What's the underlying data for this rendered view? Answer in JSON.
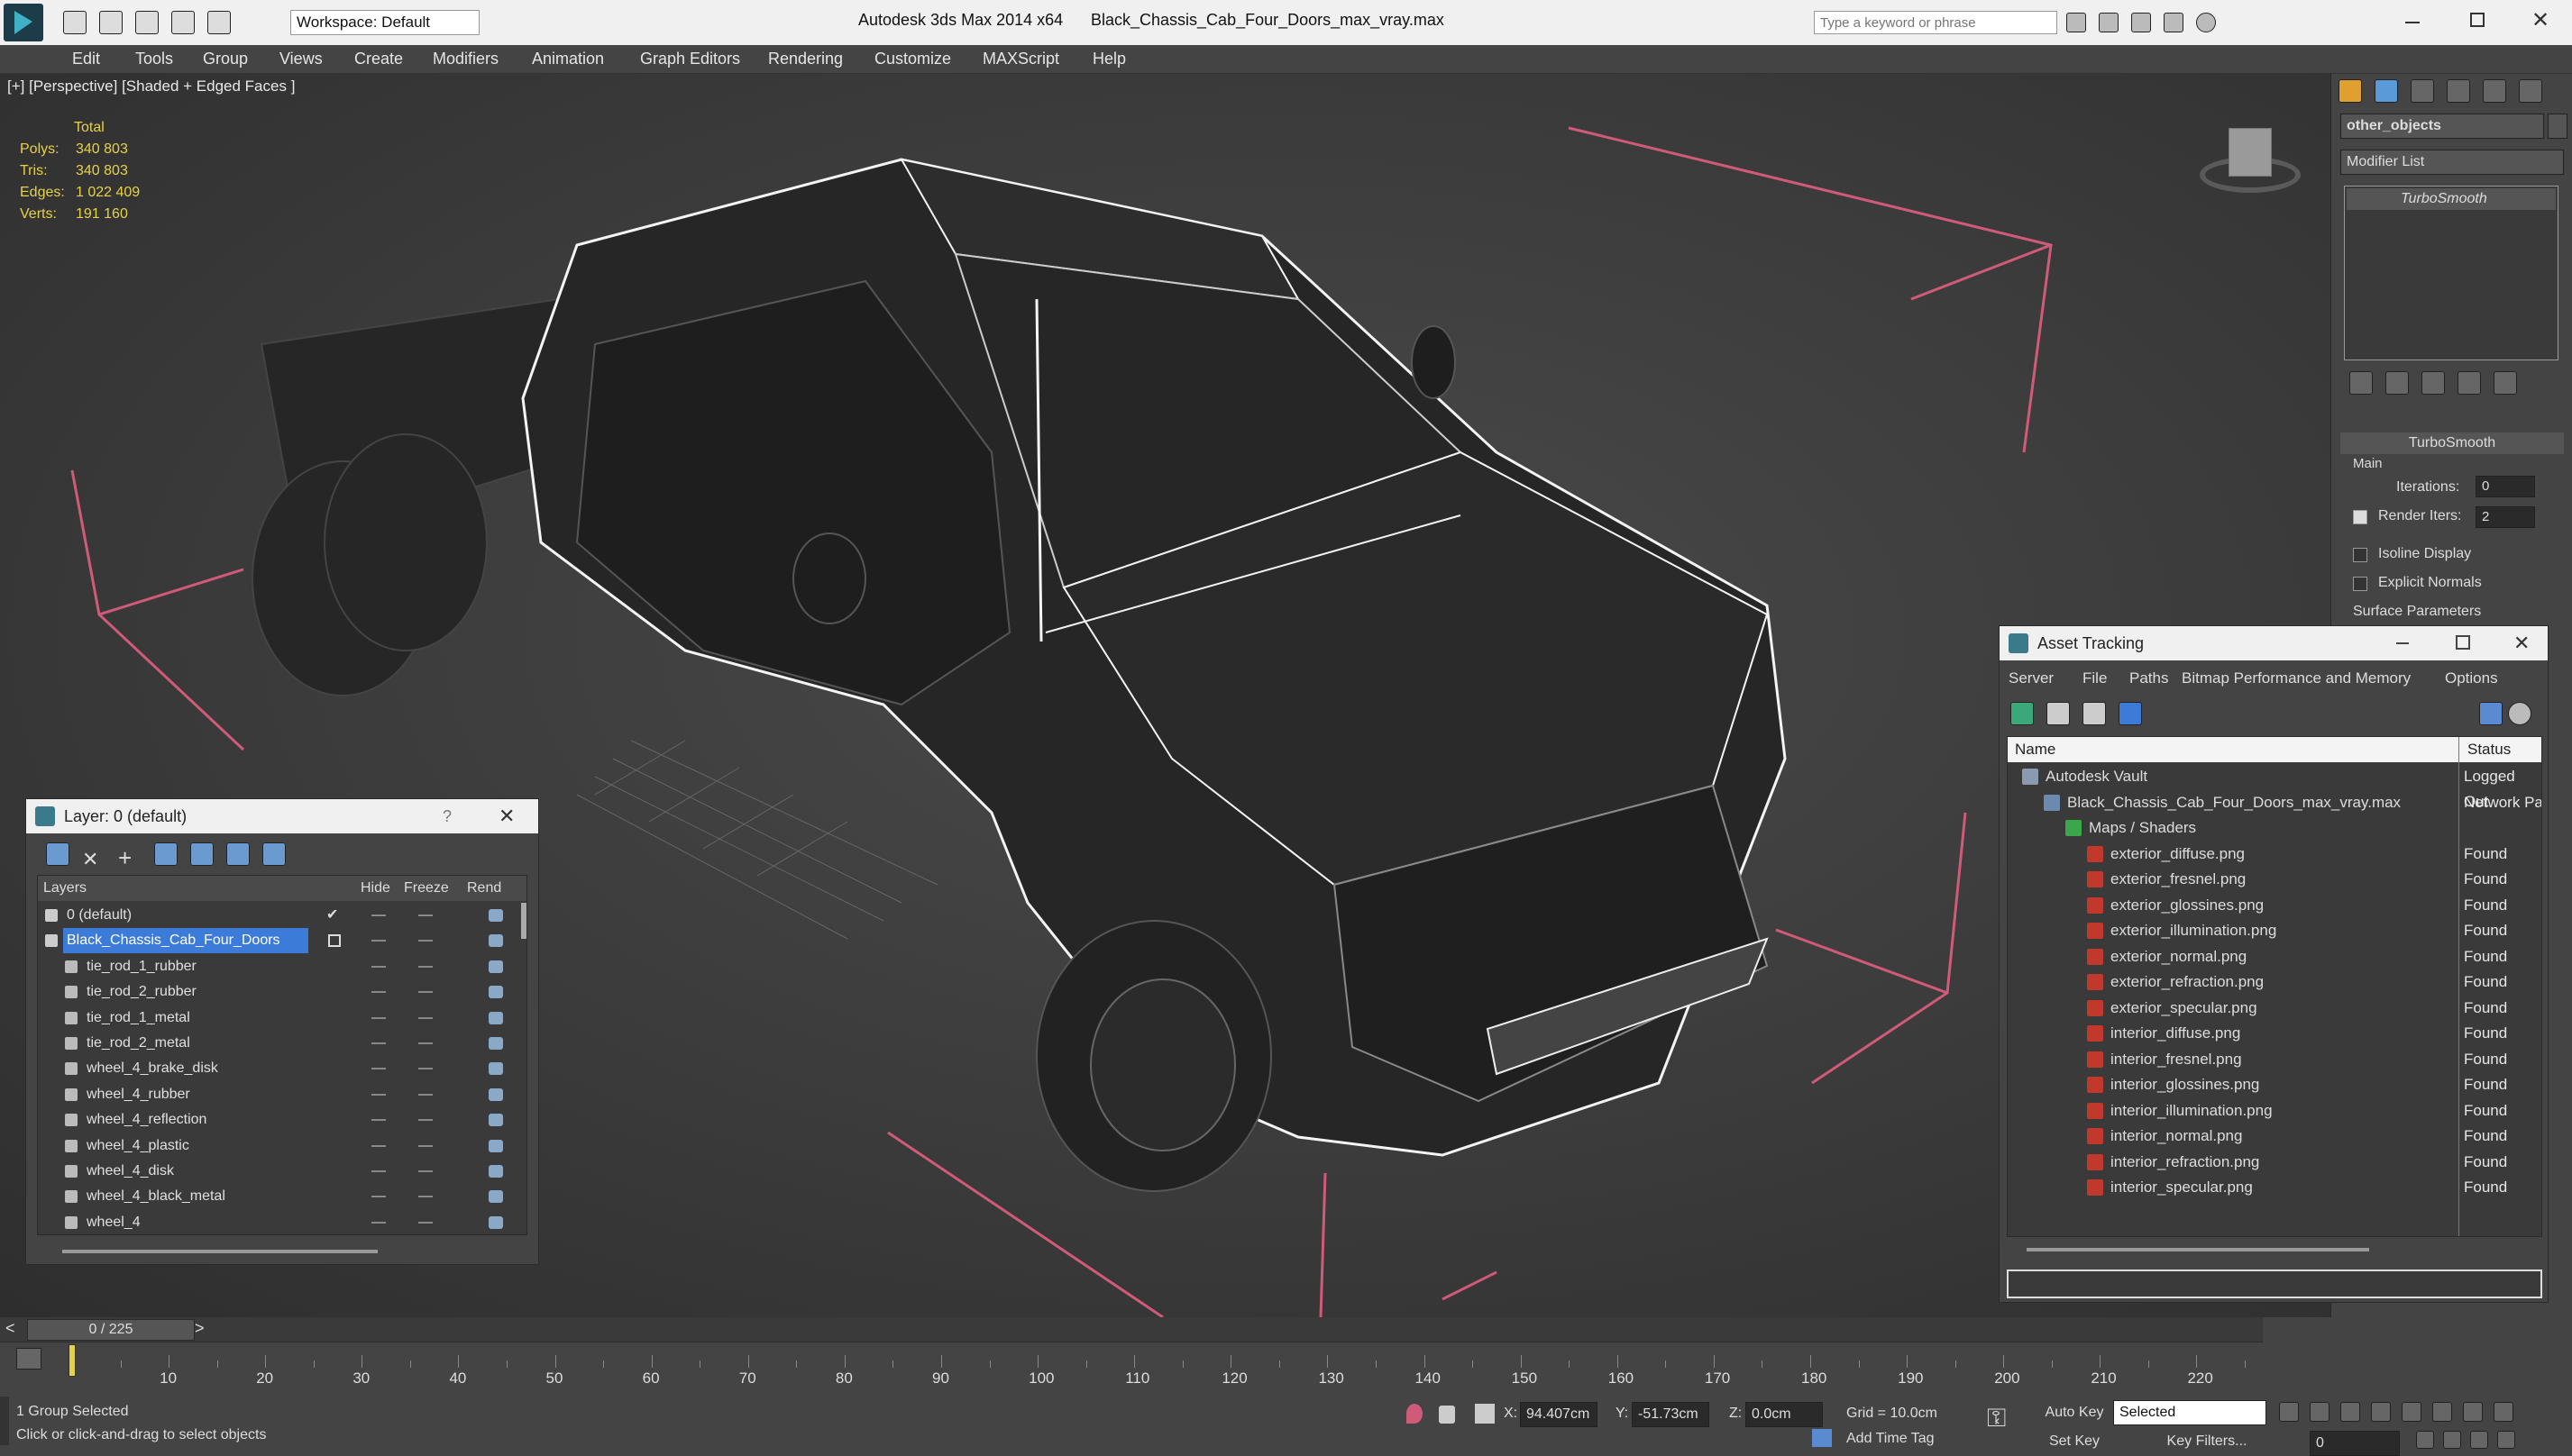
{
  "titlebar": {
    "app_title": "Autodesk 3ds Max  2014 x64",
    "file_name": "Black_Chassis_Cab_Four_Doors_max_vray.max",
    "workspace": "Workspace: Default",
    "search_placeholder": "Type a keyword or phrase"
  },
  "menu": [
    "Edit",
    "Tools",
    "Group",
    "Views",
    "Create",
    "Modifiers",
    "Animation",
    "Graph Editors",
    "Rendering",
    "Customize",
    "MAXScript",
    "Help"
  ],
  "viewport": {
    "label": "[+] [Perspective] [Shaded + Edged Faces ]",
    "stats_header": "Total",
    "stats": [
      {
        "k": "Polys:",
        "v": "340 803"
      },
      {
        "k": "Tris:",
        "v": "340 803"
      },
      {
        "k": "Edges:",
        "v": "1 022 409"
      },
      {
        "k": "Verts:",
        "v": "191 160"
      }
    ]
  },
  "command_panel": {
    "object_name": "other_objects",
    "modifier_list": "Modifier List",
    "stack_item": "TurboSmooth",
    "rollout_title": "TurboSmooth",
    "group_main": "Main",
    "iterations_label": "Iterations:",
    "iterations_value": "0",
    "render_iters_label": "Render Iters:",
    "render_iters_value": "2",
    "isoline_label": "Isoline Display",
    "explicit_normals_label": "Explicit Normals",
    "surface_params": "Surface Parameters"
  },
  "layer_panel": {
    "title": "Layer: 0 (default)",
    "help": "?",
    "col_layers": "Layers",
    "col_hide": "Hide",
    "col_freeze": "Freeze",
    "col_render": "Rend",
    "rows": [
      {
        "name": "0 (default)",
        "indent": 0,
        "selected": false
      },
      {
        "name": "Black_Chassis_Cab_Four_Doors",
        "indent": 0,
        "selected": true
      },
      {
        "name": "tie_rod_1_rubber",
        "indent": 1,
        "selected": false
      },
      {
        "name": "tie_rod_2_rubber",
        "indent": 1,
        "selected": false
      },
      {
        "name": "tie_rod_1_metal",
        "indent": 1,
        "selected": false
      },
      {
        "name": "tie_rod_2_metal",
        "indent": 1,
        "selected": false
      },
      {
        "name": "wheel_4_brake_disk",
        "indent": 1,
        "selected": false
      },
      {
        "name": "wheel_4_rubber",
        "indent": 1,
        "selected": false
      },
      {
        "name": "wheel_4_reflection",
        "indent": 1,
        "selected": false
      },
      {
        "name": "wheel_4_plastic",
        "indent": 1,
        "selected": false
      },
      {
        "name": "wheel_4_disk",
        "indent": 1,
        "selected": false
      },
      {
        "name": "wheel_4_black_metal",
        "indent": 1,
        "selected": false
      },
      {
        "name": "wheel_4",
        "indent": 1,
        "selected": false
      }
    ]
  },
  "asset_panel": {
    "title": "Asset Tracking",
    "menu": [
      "Server",
      "File",
      "Paths",
      "Bitmap Performance and Memory",
      "Options"
    ],
    "col_name": "Name",
    "col_status": "Status",
    "rows": [
      {
        "name": "Autodesk Vault",
        "status": "Logged Out",
        "level": 0,
        "type": "vault"
      },
      {
        "name": "Black_Chassis_Cab_Four_Doors_max_vray.max",
        "status": "Network Pa",
        "level": 1,
        "type": "max"
      },
      {
        "name": "Maps / Shaders",
        "status": "",
        "level": 2,
        "type": "folder"
      },
      {
        "name": "exterior_diffuse.png",
        "status": "Found",
        "level": 3,
        "type": "png"
      },
      {
        "name": "exterior_fresnel.png",
        "status": "Found",
        "level": 3,
        "type": "png"
      },
      {
        "name": "exterior_glossines.png",
        "status": "Found",
        "level": 3,
        "type": "png"
      },
      {
        "name": "exterior_illumination.png",
        "status": "Found",
        "level": 3,
        "type": "png"
      },
      {
        "name": "exterior_normal.png",
        "status": "Found",
        "level": 3,
        "type": "png"
      },
      {
        "name": "exterior_refraction.png",
        "status": "Found",
        "level": 3,
        "type": "png"
      },
      {
        "name": "exterior_specular.png",
        "status": "Found",
        "level": 3,
        "type": "png"
      },
      {
        "name": "interior_diffuse.png",
        "status": "Found",
        "level": 3,
        "type": "png"
      },
      {
        "name": "interior_fresnel.png",
        "status": "Found",
        "level": 3,
        "type": "png"
      },
      {
        "name": "interior_glossines.png",
        "status": "Found",
        "level": 3,
        "type": "png"
      },
      {
        "name": "interior_illumination.png",
        "status": "Found",
        "level": 3,
        "type": "png"
      },
      {
        "name": "interior_normal.png",
        "status": "Found",
        "level": 3,
        "type": "png"
      },
      {
        "name": "interior_refraction.png",
        "status": "Found",
        "level": 3,
        "type": "png"
      },
      {
        "name": "interior_specular.png",
        "status": "Found",
        "level": 3,
        "type": "png"
      }
    ]
  },
  "timeline": {
    "frame_counter": "0 / 225",
    "ticks": [
      "10",
      "20",
      "30",
      "40",
      "50",
      "60",
      "70",
      "80",
      "90",
      "100",
      "110",
      "120",
      "130",
      "140",
      "150",
      "160",
      "170",
      "180",
      "190",
      "200",
      "210",
      "220"
    ],
    "frame_current": 0,
    "frame_total": 225
  },
  "statusbar": {
    "selection": "1 Group Selected",
    "prompt": "Click or click-and-drag to select objects",
    "x_label": "X:",
    "x_value": "94.407cm",
    "y_label": "Y:",
    "y_value": "-51.73cm",
    "z_label": "Z:",
    "z_value": "0.0cm",
    "grid": "Grid = 10.0cm",
    "add_time_tag": "Add Time Tag",
    "auto_key": "Auto Key",
    "set_key": "Set Key",
    "selected": "Selected",
    "key_filters": "Key Filters...",
    "frame_field": "0"
  },
  "colors": {
    "accent_blue": "#3d7bd9",
    "stat_yellow": "#e6d14a",
    "bbox_pink": "#d05a7a",
    "wire_white": "#f4f4f4"
  }
}
